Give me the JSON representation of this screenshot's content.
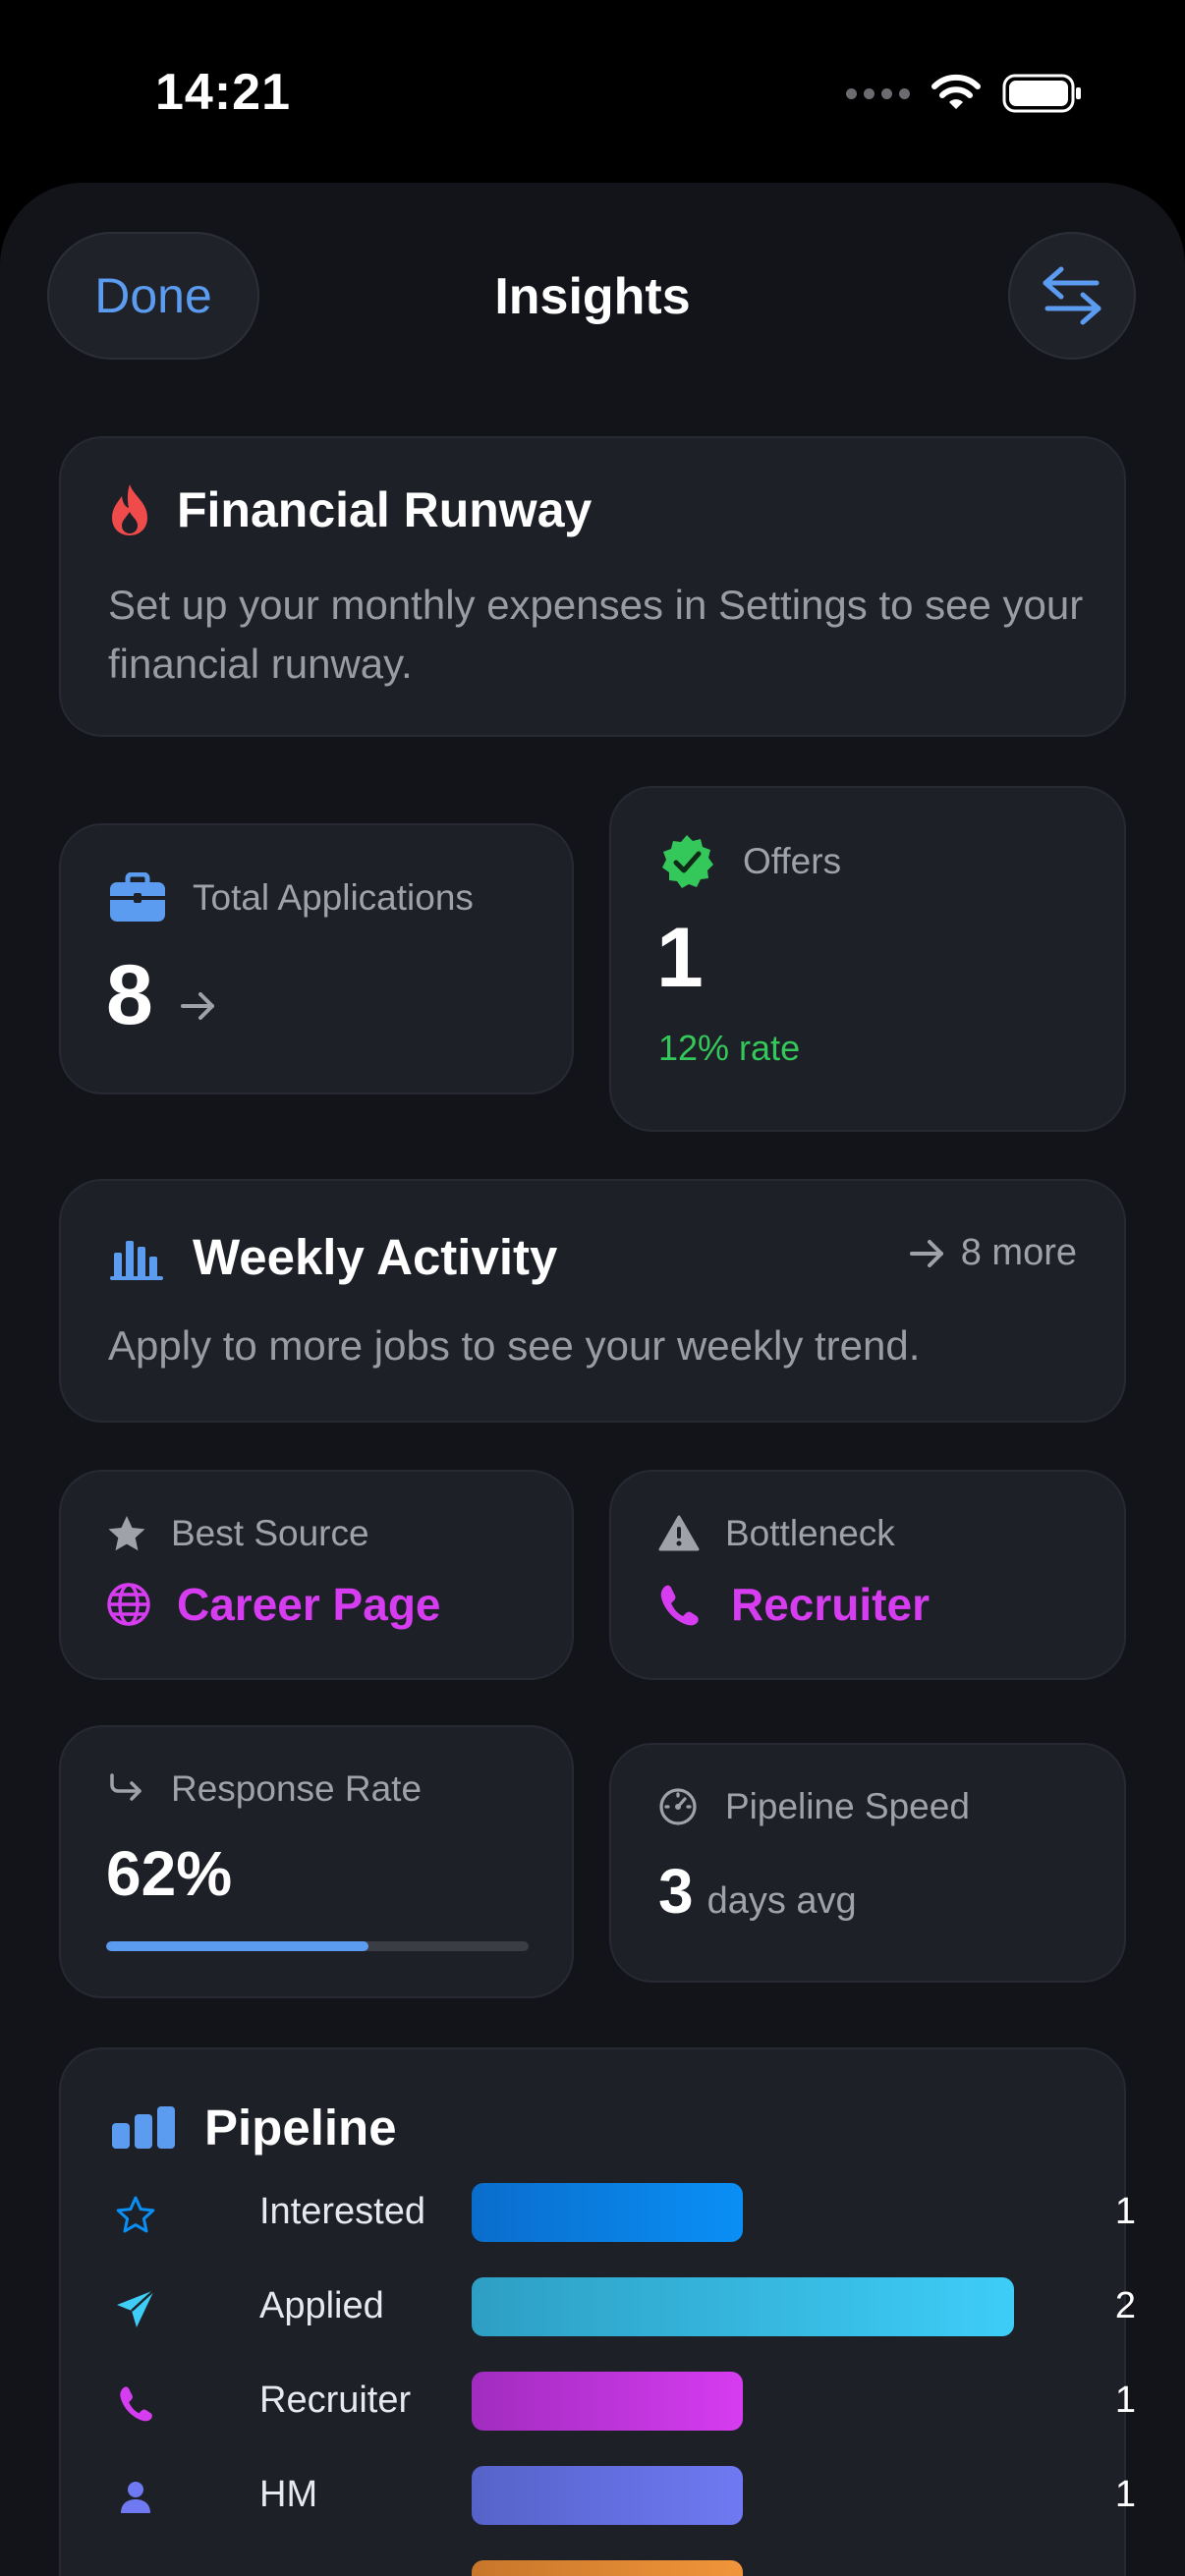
{
  "status_bar": {
    "time": "14:21"
  },
  "nav": {
    "done_label": "Done",
    "title": "Insights"
  },
  "financial_runway": {
    "title": "Financial Runway",
    "description": "Set up your monthly expenses in Settings to see your financial runway."
  },
  "total_applications": {
    "label": "Total Applications",
    "value": "8"
  },
  "offers": {
    "label": "Offers",
    "value": "1",
    "rate_text": "12% rate"
  },
  "weekly_activity": {
    "title": "Weekly Activity",
    "more_label": "8 more",
    "description": "Apply to more jobs to see your weekly trend."
  },
  "best_source": {
    "label": "Best Source",
    "value": "Career Page"
  },
  "bottleneck": {
    "label": "Bottleneck",
    "value": "Recruiter"
  },
  "response_rate": {
    "label": "Response Rate",
    "value": "62%",
    "fraction": 0.62
  },
  "pipeline_speed": {
    "label": "Pipeline Speed",
    "value": "3",
    "unit": "days avg"
  },
  "pipeline": {
    "title": "Pipeline",
    "stages": [
      {
        "label": "Interested",
        "count": "1",
        "icon": "star-icon",
        "color_from": "#0a6dcc",
        "color_to": "#0a8ff5"
      },
      {
        "label": "Applied",
        "count": "2",
        "icon": "paper-plane-icon",
        "color_from": "#2e9fc4",
        "color_to": "#3dcdf7"
      },
      {
        "label": "Recruiter",
        "count": "1",
        "icon": "phone-icon",
        "color_from": "#a12cbf",
        "color_to": "#d63cf0"
      },
      {
        "label": "HM",
        "count": "1",
        "icon": "person-icon",
        "color_from": "#5563c9",
        "color_to": "#6f79f2"
      }
    ]
  },
  "colors": {
    "accent_blue": "#5b9cf0",
    "success_green": "#34c759",
    "magenta": "#d63cf0",
    "flame_red": "#ef4b4b"
  }
}
